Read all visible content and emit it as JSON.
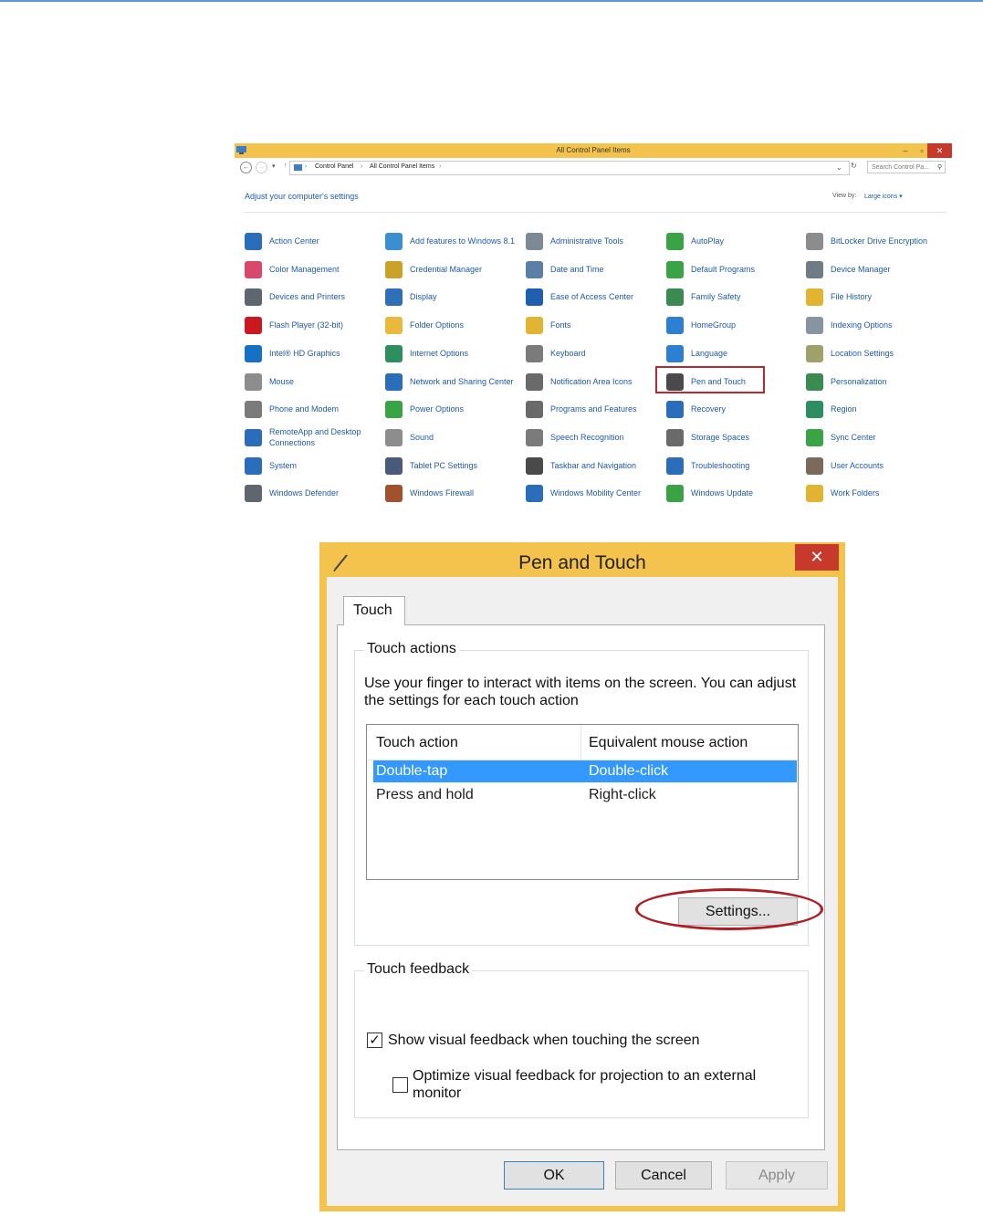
{
  "control_panel": {
    "title": "All Control Panel Items",
    "title_buttons": {
      "minimize": "–",
      "maximize": "▫",
      "close": "✕"
    },
    "breadcrumb": [
      "Control Panel",
      "All Control Panel Items"
    ],
    "search_placeholder": "Search Control Pa...",
    "heading": "Adjust your computer's settings",
    "view_by_label": "View by:",
    "view_by_value": "Large icons ▾",
    "highlighted_item": "Pen and Touch",
    "items": [
      {
        "label": "Action Center",
        "icon": "flag-icon",
        "color": "#2a6ebb"
      },
      {
        "label": "Add features to Windows 8.1",
        "icon": "windows-features-icon",
        "color": "#3a8fd0"
      },
      {
        "label": "Administrative Tools",
        "icon": "admin-tools-icon",
        "color": "#7c8a96"
      },
      {
        "label": "AutoPlay",
        "icon": "autoplay-icon",
        "color": "#3aa346"
      },
      {
        "label": "BitLocker Drive Encryption",
        "icon": "bitlocker-key-icon",
        "color": "#8c8c8c"
      },
      {
        "label": "Color Management",
        "icon": "color-management-icon",
        "color": "#d9486a"
      },
      {
        "label": "Credential Manager",
        "icon": "credential-manager-icon",
        "color": "#c9a227"
      },
      {
        "label": "Date and Time",
        "icon": "clock-icon",
        "color": "#5b7fa6"
      },
      {
        "label": "Default Programs",
        "icon": "default-programs-icon",
        "color": "#3aa346"
      },
      {
        "label": "Device Manager",
        "icon": "device-manager-icon",
        "color": "#6f7b85"
      },
      {
        "label": "Devices and Printers",
        "icon": "printer-icon",
        "color": "#5e6770"
      },
      {
        "label": "Display",
        "icon": "display-icon",
        "color": "#2f6fb7"
      },
      {
        "label": "Ease of Access Center",
        "icon": "ease-of-access-icon",
        "color": "#1f5fb0"
      },
      {
        "label": "Family Safety",
        "icon": "family-safety-icon",
        "color": "#3b8a4f"
      },
      {
        "label": "File History",
        "icon": "file-history-icon",
        "color": "#e3b431"
      },
      {
        "label": "Flash Player (32-bit)",
        "icon": "flash-icon",
        "color": "#c9181e"
      },
      {
        "label": "Folder Options",
        "icon": "folder-icon",
        "color": "#e8b93a"
      },
      {
        "label": "Fonts",
        "icon": "fonts-icon",
        "color": "#e3b431"
      },
      {
        "label": "HomeGroup",
        "icon": "homegroup-icon",
        "color": "#2d7fd1"
      },
      {
        "label": "Indexing Options",
        "icon": "indexing-icon",
        "color": "#8795a2"
      },
      {
        "label": "Intel® HD Graphics",
        "icon": "intel-graphics-icon",
        "color": "#1670c4"
      },
      {
        "label": "Internet Options",
        "icon": "internet-options-icon",
        "color": "#2d8f5f"
      },
      {
        "label": "Keyboard",
        "icon": "keyboard-icon",
        "color": "#7b7b7b"
      },
      {
        "label": "Language",
        "icon": "language-icon",
        "color": "#2d7fd1"
      },
      {
        "label": "Location Settings",
        "icon": "location-icon",
        "color": "#a0a06a"
      },
      {
        "label": "Mouse",
        "icon": "mouse-icon",
        "color": "#8d8d8d"
      },
      {
        "label": "Network and Sharing Center",
        "icon": "network-icon",
        "color": "#2a6ebb"
      },
      {
        "label": "Notification Area Icons",
        "icon": "notification-area-icon",
        "color": "#6a6a6a"
      },
      {
        "label": "Pen and Touch",
        "icon": "pen-icon",
        "color": "#4a4a4a"
      },
      {
        "label": "Personalization",
        "icon": "personalization-icon",
        "color": "#3b8a4f"
      },
      {
        "label": "Phone and Modem",
        "icon": "phone-icon",
        "color": "#7b7b7b"
      },
      {
        "label": "Power Options",
        "icon": "power-icon",
        "color": "#3aa346"
      },
      {
        "label": "Programs and Features",
        "icon": "programs-icon",
        "color": "#6a6a6a"
      },
      {
        "label": "Recovery",
        "icon": "recovery-icon",
        "color": "#2a6ebb"
      },
      {
        "label": "Region",
        "icon": "region-icon",
        "color": "#2d8f5f"
      },
      {
        "label": "RemoteApp and Desktop Connections",
        "icon": "remoteapp-icon",
        "color": "#2a6ebb"
      },
      {
        "label": "Sound",
        "icon": "sound-icon",
        "color": "#8d8d8d"
      },
      {
        "label": "Speech Recognition",
        "icon": "microphone-icon",
        "color": "#7b7b7b"
      },
      {
        "label": "Storage Spaces",
        "icon": "storage-spaces-icon",
        "color": "#6a6a6a"
      },
      {
        "label": "Sync Center",
        "icon": "sync-icon",
        "color": "#3aa346"
      },
      {
        "label": "System",
        "icon": "system-icon",
        "color": "#2a6ebb"
      },
      {
        "label": "Tablet PC Settings",
        "icon": "tablet-icon",
        "color": "#4a5a7a"
      },
      {
        "label": "Taskbar and Navigation",
        "icon": "taskbar-icon",
        "color": "#4a4a4a"
      },
      {
        "label": "Troubleshooting",
        "icon": "troubleshooting-icon",
        "color": "#2a6ebb"
      },
      {
        "label": "User Accounts",
        "icon": "user-accounts-icon",
        "color": "#7b6a5a"
      },
      {
        "label": "Windows Defender",
        "icon": "defender-icon",
        "color": "#5e6770"
      },
      {
        "label": "Windows Firewall",
        "icon": "firewall-icon",
        "color": "#a0522d"
      },
      {
        "label": "Windows Mobility Center",
        "icon": "mobility-center-icon",
        "color": "#2a6ebb"
      },
      {
        "label": "Windows Update",
        "icon": "windows-update-icon",
        "color": "#3aa346"
      },
      {
        "label": "Work Folders",
        "icon": "work-folders-icon",
        "color": "#e3b431"
      }
    ]
  },
  "dialog": {
    "title": "Pen and Touch",
    "close_glyph": "✕",
    "tab": "Touch",
    "touch_actions": {
      "title": "Touch actions",
      "description": "Use your finger to interact with items on the screen. You can adjust the settings for each touch action",
      "columns": [
        "Touch action",
        "Equivalent mouse action"
      ],
      "rows": [
        {
          "action": "Double-tap",
          "mouse": "Double-click",
          "selected": true
        },
        {
          "action": "Press and hold",
          "mouse": "Right-click",
          "selected": false
        }
      ],
      "settings_button": "Settings..."
    },
    "touch_feedback": {
      "title": "Touch feedback",
      "show_visual_feedback": {
        "label": "Show visual feedback when touching the screen",
        "checked": true
      },
      "optimize_projection": {
        "label": "Optimize visual feedback for projection to an external monitor",
        "checked": false
      }
    },
    "buttons": {
      "ok": "OK",
      "cancel": "Cancel",
      "apply": "Apply"
    }
  },
  "colors": {
    "titlebar": "#f4c34e",
    "close_button": "#c7392b",
    "link": "#1e5aa8",
    "selection": "#3399ff",
    "highlight_red": "#c0272d"
  }
}
